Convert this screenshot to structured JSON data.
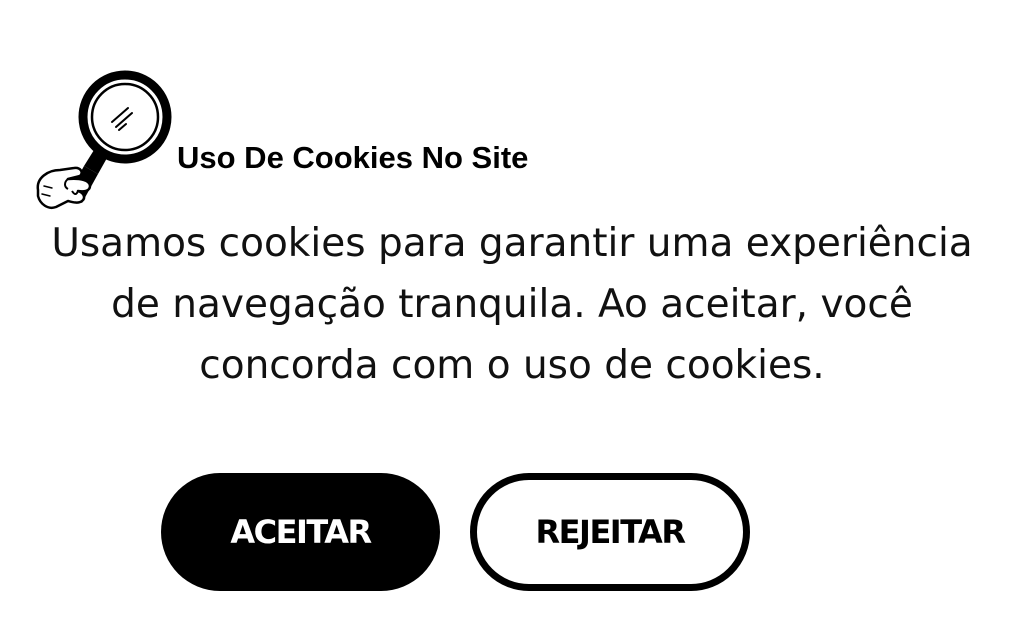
{
  "dialog": {
    "title": "Uso De Cookies No Site",
    "message_lines": [
      "Usamos cookies para garantir uma experiência",
      "de navegação tranquila. Ao aceitar, você",
      "concorda com o uso de cookies."
    ],
    "icon": "magnifying-glass-hand-icon"
  },
  "buttons": {
    "accept_label": "ACEITAR",
    "reject_label": "REJEITAR"
  },
  "colors": {
    "background": "#ffffff",
    "text": "#000000",
    "accept_bg": "#000000",
    "accept_text": "#ffffff"
  }
}
